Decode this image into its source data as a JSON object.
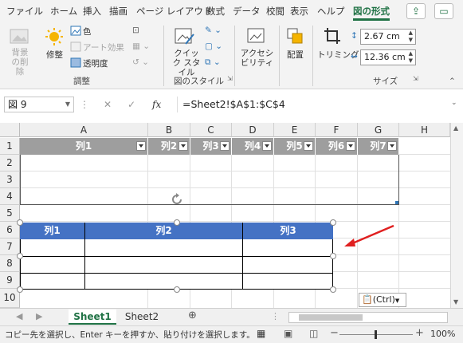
{
  "tabs": [
    "ファイル",
    "ホーム",
    "挿入",
    "描画",
    "ページ レイアウト",
    "数式",
    "データ",
    "校閲",
    "表示",
    "ヘルプ",
    "図の形式"
  ],
  "ribbon": {
    "remove_bg": "背景の削除",
    "corrections": "修整",
    "color": "色",
    "artistic": "アート効果",
    "transparency": "透明度",
    "quick_styles": "クイック スタイル",
    "accessibility": "アクセシビリティ",
    "arrange": "配置",
    "crop": "トリミング",
    "height": "2.67 cm",
    "width": "12.36 cm",
    "groups": {
      "adjust": "調整",
      "styles": "図のスタイル",
      "size": "サイズ"
    }
  },
  "formula_bar": {
    "name_box": "図 9",
    "formula": "=Sheet2!$A$1:$C$4"
  },
  "columns": [
    "A",
    "B",
    "C",
    "D",
    "E",
    "F",
    "G",
    "H"
  ],
  "rows": [
    "1",
    "2",
    "3",
    "4",
    "5",
    "6",
    "7",
    "8",
    "9",
    "10"
  ],
  "table1_headers": [
    "列1",
    "列2",
    "列3",
    "列4",
    "列5",
    "列6",
    "列7"
  ],
  "table2_headers": [
    "列1",
    "列2",
    "列3"
  ],
  "paste_options": "(Ctrl)",
  "sheets": [
    "Sheet1",
    "Sheet2"
  ],
  "status": {
    "message": "コピー先を選択し、Enter キーを押すか、貼り付けを選択します。",
    "zoom": "100%"
  },
  "colors": {
    "accent": "#217346",
    "table_header_gray": "#9e9e9e",
    "table_header_blue": "#4472c4",
    "arrow": "#e02020"
  }
}
